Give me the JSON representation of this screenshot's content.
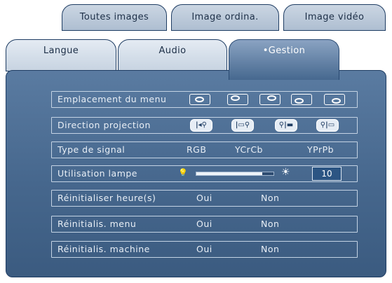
{
  "tabs_back": [
    {
      "label": "Toutes images"
    },
    {
      "label": "Image ordina."
    },
    {
      "label": "Image vidéo"
    }
  ],
  "tabs_front": [
    {
      "label": "Langue"
    },
    {
      "label": "Audio"
    },
    {
      "label": "•Gestion"
    }
  ],
  "rows": {
    "menu_location": {
      "label": "Emplacement du menu"
    },
    "projection": {
      "label": "Direction projection",
      "options": [
        "|◂⚲",
        "|▭⚲",
        "⚲|▬",
        "⚲|▭"
      ]
    },
    "signal": {
      "label": "Type de signal",
      "options": [
        "RGB",
        "YCrCb",
        "YPrPb"
      ]
    },
    "lamp": {
      "label": "Utilisation lampe",
      "value": "10",
      "level": 0.85
    },
    "reset_hours": {
      "label": "Réinitialiser heure(s)",
      "yes": "Oui",
      "no": "Non"
    },
    "reset_menu": {
      "label": "Réinitialis. menu",
      "yes": "Oui",
      "no": "Non"
    },
    "reset_machine": {
      "label": "Réinitialis. machine",
      "yes": "Oui",
      "no": "Non"
    }
  },
  "icons": {
    "lamp_low": "💡",
    "lamp_high": "☀"
  }
}
